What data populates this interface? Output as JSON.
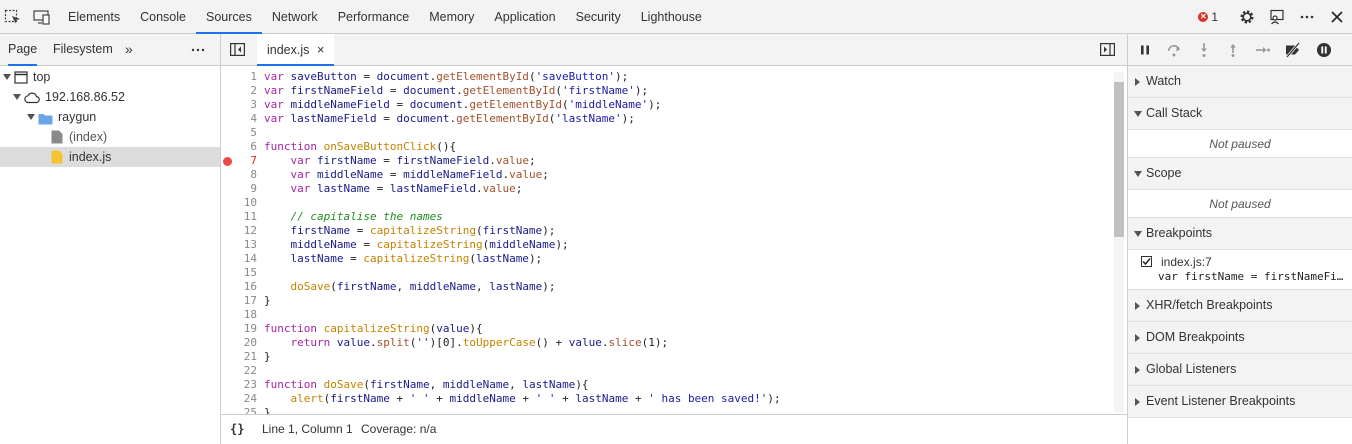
{
  "toolbar": {
    "tabs": [
      "Elements",
      "Console",
      "Sources",
      "Network",
      "Performance",
      "Memory",
      "Application",
      "Security",
      "Lighthouse"
    ],
    "active_tab": "Sources",
    "error_count": "1",
    "icons": [
      "inspect-icon",
      "device-toggle-icon",
      "settings-icon",
      "feedback-icon",
      "more-icon",
      "close-icon"
    ]
  },
  "navigator": {
    "tabs": [
      "Page",
      "Filesystem"
    ],
    "more": "»",
    "menu": "⋮",
    "tree": [
      {
        "label": "top"
      },
      {
        "label": "192.168.86.52"
      },
      {
        "label": "raygun"
      },
      {
        "label": "(index)"
      },
      {
        "label": "index.js"
      }
    ]
  },
  "editor": {
    "file_tab": "index.js",
    "close": "×",
    "breakpoint_line": 7,
    "lines": [
      {
        "n": "1",
        "code": "var saveButton = document.getElementById('saveButton');"
      },
      {
        "n": "2",
        "code": "var firstNameField = document.getElementById('firstName');"
      },
      {
        "n": "3",
        "code": "var middleNameField = document.getElementById('middleName');"
      },
      {
        "n": "4",
        "code": "var lastNameField = document.getElementById('lastName');"
      },
      {
        "n": "5",
        "code": ""
      },
      {
        "n": "6",
        "code": "function onSaveButtonClick(){"
      },
      {
        "n": "7",
        "code": "    var firstName = firstNameField.value;"
      },
      {
        "n": "8",
        "code": "    var middleName = middleNameField.value;"
      },
      {
        "n": "9",
        "code": "    var lastName = lastNameField.value;"
      },
      {
        "n": "10",
        "code": ""
      },
      {
        "n": "11",
        "code": "    // capitalise the names"
      },
      {
        "n": "12",
        "code": "    firstName = capitalizeString(firstName);"
      },
      {
        "n": "13",
        "code": "    middleName = capitalizeString(middleName);"
      },
      {
        "n": "14",
        "code": "    lastName = capitalizeString(lastName);"
      },
      {
        "n": "15",
        "code": ""
      },
      {
        "n": "16",
        "code": "    doSave(firstName, middleName, lastName);"
      },
      {
        "n": "17",
        "code": "}"
      },
      {
        "n": "18",
        "code": ""
      },
      {
        "n": "19",
        "code": "function capitalizeString(value){"
      },
      {
        "n": "20",
        "code": "    return value.split('')[0].toUpperCase() + value.slice(1);"
      },
      {
        "n": "21",
        "code": "}"
      },
      {
        "n": "22",
        "code": ""
      },
      {
        "n": "23",
        "code": "function doSave(firstName, middleName, lastName){"
      },
      {
        "n": "24",
        "code": "    alert(firstName + ' ' + middleName + ' ' + lastName + ' has been saved!');"
      },
      {
        "n": "25",
        "code": "}"
      }
    ],
    "status": {
      "format": "{}",
      "position": "Line 1, Column 1",
      "coverage": "Coverage: n/a"
    }
  },
  "debugger": {
    "sections": {
      "watch": "Watch",
      "call_stack": "Call Stack",
      "scope": "Scope",
      "breakpoints": "Breakpoints",
      "xhr": "XHR/fetch Breakpoints",
      "dom": "DOM Breakpoints",
      "global": "Global Listeners",
      "event": "Event Listener Breakpoints"
    },
    "not_paused": "Not paused",
    "breakpoint_item": {
      "location": "index.js:7",
      "code": "var firstName = firstNameFi…",
      "checked": true
    }
  }
}
